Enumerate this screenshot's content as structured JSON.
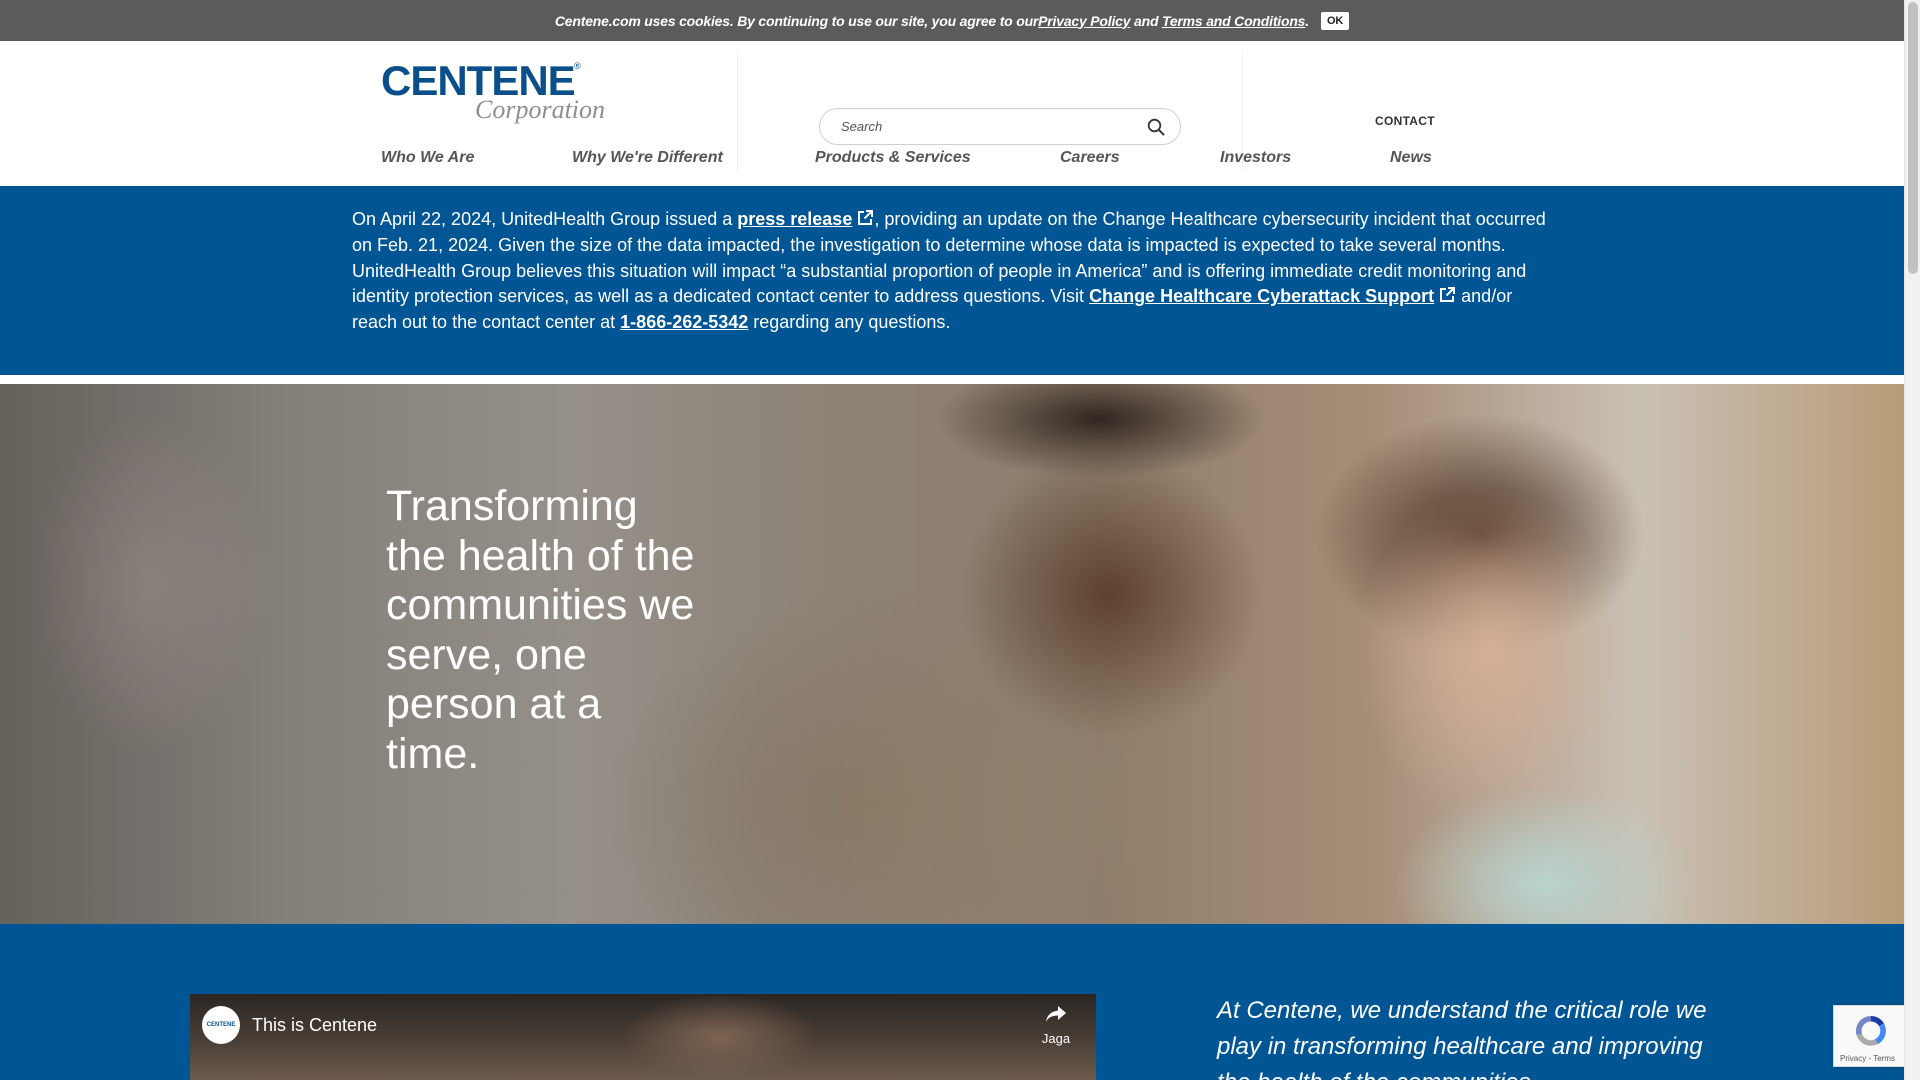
{
  "cookie_bar": {
    "text_prefix": "Centene.com uses cookies. By continuing to use our site, you agree to our ",
    "privacy_link": "Privacy Policy",
    "and_text": " and ",
    "terms_link": "Terms and Conditions",
    "period": ".",
    "ok_label": "OK"
  },
  "header": {
    "logo_word1": "CENTENE",
    "logo_reg": "®",
    "logo_word2": "Corporation",
    "search_placeholder": "Search",
    "contact_label": "CONTACT"
  },
  "nav": {
    "items": [
      "Who We Are",
      "Why We're Different",
      "Products & Services",
      "Careers",
      "Investors",
      "News"
    ]
  },
  "notice": {
    "part1": "On April 22, 2024, UnitedHealth Group issued a ",
    "press_link": "press release",
    "part2": ", providing an update on the Change Healthcare cybersecurity incident that occurred on Feb. 21, 2024. Given the size of the data impacted, the investigation to determine whose data is impacted is expected to take several months. UnitedHealth Group believes this situation will impact “a substantial proportion of people in America” and is offering immediate credit monitoring and identity protection services, as well as a dedicated contact center to address questions. Visit ",
    "support_link": "Change Healthcare Cyberattack Support",
    "part3": " and/or reach out to the contact center at ",
    "phone_link": "1-866-262-5342",
    "part4": " regarding any questions."
  },
  "hero": {
    "headline": "Transforming the health of the communities we serve, one person at a time."
  },
  "video": {
    "channel_avatar": "CENTENE",
    "title": "This is Centene",
    "share_label": "Jaga"
  },
  "quote": {
    "text": "At Centene, we understand the critical role we play in transforming healthcare and improving the health of the communities"
  },
  "recaptcha": {
    "terms": "Privacy - Terms"
  },
  "colors": {
    "brand_blue": "#005594",
    "logo_blue": "#0a4f8a",
    "cookie_bar_bg": "#5b5b5b"
  }
}
